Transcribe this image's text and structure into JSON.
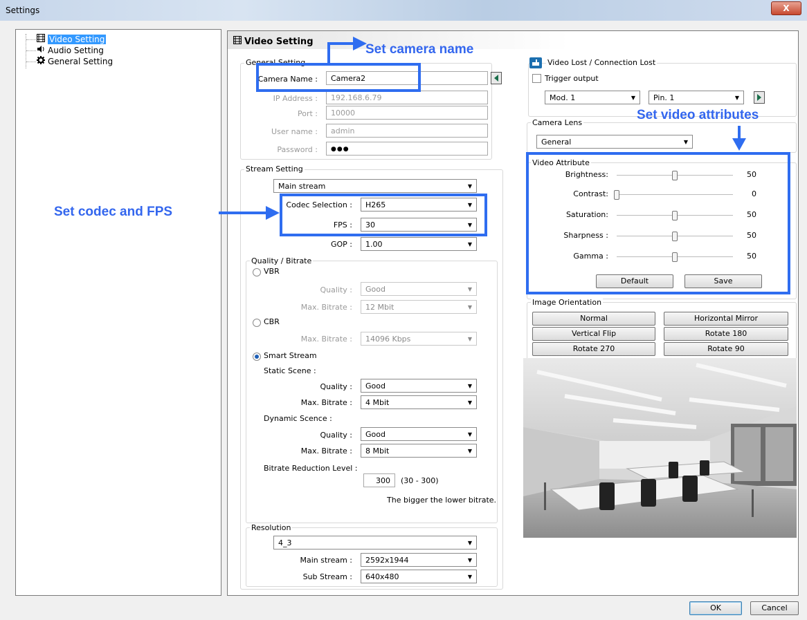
{
  "window": {
    "title": "Settings",
    "close_glyph": "X"
  },
  "tree": [
    {
      "label": "Video Setting",
      "icon": "video-icon"
    },
    {
      "label": "Audio Setting",
      "icon": "speaker-icon"
    },
    {
      "label": "General Setting",
      "icon": "gear-icon"
    }
  ],
  "panel": {
    "title": "Video Setting"
  },
  "general": {
    "label": "General Setting",
    "camera_name_label": "Camera Name :",
    "camera_name": "Camera2",
    "ip_label": "IP Address :",
    "ip": "192.168.6.79",
    "port_label": "Port :",
    "port": "10000",
    "user_label": "User name :",
    "user": "admin",
    "pass_label": "Password :",
    "pass": "●●●"
  },
  "stream": {
    "label": "Stream Setting",
    "stream": "Main stream",
    "codec_label": "Codec Selection :",
    "codec": "H265",
    "fps_label": "FPS :",
    "fps": "30",
    "gop_label": "GOP :",
    "gop": "1.00"
  },
  "quality": {
    "label": "Quality / Bitrate",
    "vbr": "VBR",
    "vbr_quality_label": "Quality :",
    "vbr_quality": "Good",
    "vbr_max_label": "Max. Bitrate :",
    "vbr_max": "12 Mbit",
    "cbr": "CBR",
    "cbr_max_label": "Max. Bitrate :",
    "cbr_max": "14096  Kbps",
    "smart": "Smart Stream",
    "selected": "smart",
    "static_label": "Static Scene :",
    "static_quality_label": "Quality :",
    "static_quality": "Good",
    "static_max_label": "Max. Bitrate :",
    "static_max": "4 Mbit",
    "dynamic_label": "Dynamic Scence :",
    "dynamic_quality_label": "Quality :",
    "dynamic_quality": "Good",
    "dynamic_max_label": "Max. Bitrate :",
    "dynamic_max": "8 Mbit",
    "reduction_label": "Bitrate Reduction Level :",
    "reduction": "300",
    "reduction_range": "(30 - 300)",
    "reduction_hint": "The bigger the lower bitrate."
  },
  "resolution": {
    "label": "Resolution",
    "aspect": "4_3",
    "main_label": "Main stream :",
    "main": "2592x1944",
    "sub_label": "Sub Stream :",
    "sub": "640x480"
  },
  "video_lost": {
    "label": "Video Lost / Connection Lost",
    "trigger": "Trigger output",
    "mod": "Mod. 1",
    "pin": "Pin. 1"
  },
  "lens": {
    "label": "Camera Lens",
    "value": "General"
  },
  "attributes": {
    "label": "Video Attribute",
    "items": [
      {
        "label": "Brightness:",
        "value": "50",
        "level": 0.5
      },
      {
        "label": "Contrast:",
        "value": "0",
        "level": 0.0
      },
      {
        "label": "Saturation:",
        "value": "50",
        "level": 0.5
      },
      {
        "label": "Sharpness :",
        "value": "50",
        "level": 0.5
      },
      {
        "label": "Gamma :",
        "value": "50",
        "level": 0.5
      }
    ],
    "default_btn": "Default",
    "save_btn": "Save"
  },
  "orientation": {
    "label": "Image Orientation",
    "buttons": [
      "Normal",
      "Horizontal Mirror",
      "Vertical Flip",
      "Rotate 180",
      "Rotate 270",
      "Rotate 90"
    ]
  },
  "footer": {
    "ok": "OK",
    "cancel": "Cancel"
  },
  "annotations": {
    "camera_name": "Set camera name",
    "codec": "Set codec and FPS",
    "attributes": "Set video attributes"
  },
  "colors": {
    "annotation": "#3366ee",
    "selection": "#3399ff"
  }
}
